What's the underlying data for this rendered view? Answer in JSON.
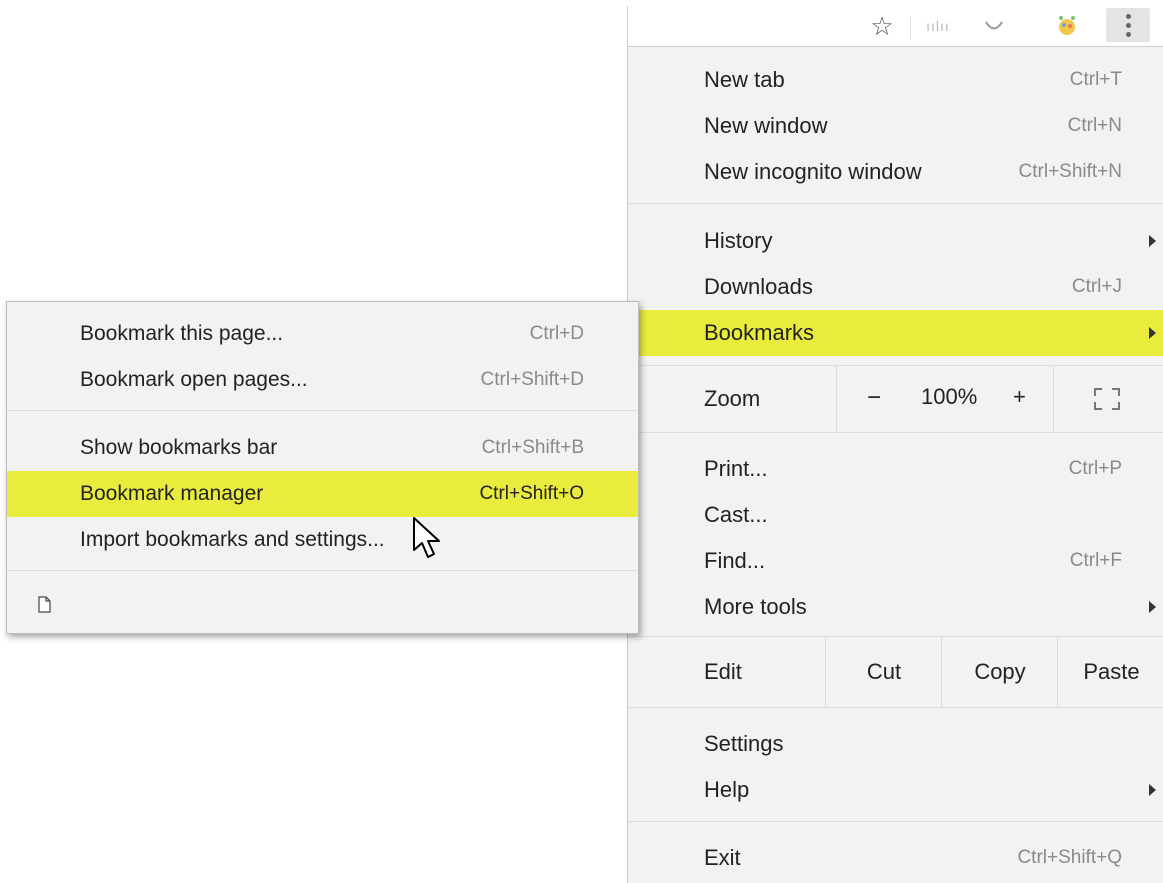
{
  "toolbar": {
    "star_icon": "star-outline-icon",
    "menu_icon": "three-dots-vertical-icon"
  },
  "menu": {
    "items_top": [
      {
        "label": "New tab",
        "shortcut": "Ctrl+T"
      },
      {
        "label": "New window",
        "shortcut": "Ctrl+N"
      },
      {
        "label": "New incognito window",
        "shortcut": "Ctrl+Shift+N"
      }
    ],
    "history": {
      "label": "History"
    },
    "downloads": {
      "label": "Downloads",
      "shortcut": "Ctrl+J"
    },
    "bookmarks": {
      "label": "Bookmarks",
      "highlight_color": "#e9ec3c"
    },
    "zoom": {
      "label": "Zoom",
      "minus": "−",
      "value": "100%",
      "plus": "+"
    },
    "print": {
      "label": "Print...",
      "shortcut": "Ctrl+P"
    },
    "cast": {
      "label": "Cast..."
    },
    "find": {
      "label": "Find...",
      "shortcut": "Ctrl+F"
    },
    "more_tools": {
      "label": "More tools"
    },
    "edit": {
      "label": "Edit",
      "cut": "Cut",
      "copy": "Copy",
      "paste": "Paste"
    },
    "settings": {
      "label": "Settings"
    },
    "help": {
      "label": "Help"
    },
    "exit": {
      "label": "Exit",
      "shortcut": "Ctrl+Shift+Q"
    }
  },
  "submenu": {
    "bookmark_page": {
      "label": "Bookmark this page...",
      "shortcut": "Ctrl+D"
    },
    "bookmark_open": {
      "label": "Bookmark open pages...",
      "shortcut": "Ctrl+Shift+D"
    },
    "show_bar": {
      "label": "Show bookmarks bar",
      "shortcut": "Ctrl+Shift+B"
    },
    "manager": {
      "label": "Bookmark manager",
      "shortcut": "Ctrl+Shift+O"
    },
    "import": {
      "label": "Import bookmarks and settings..."
    }
  }
}
